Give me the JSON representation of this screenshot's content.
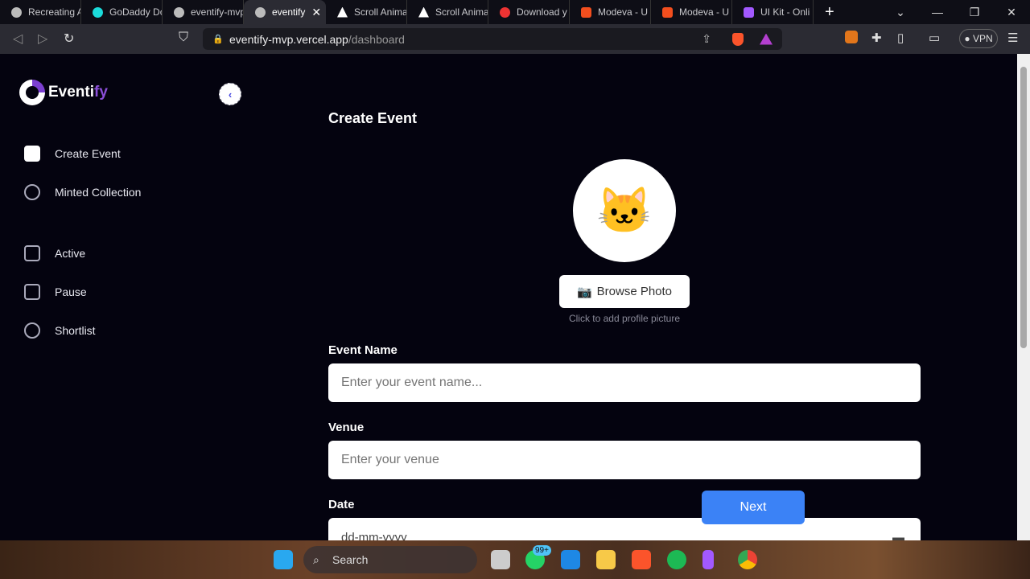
{
  "browser": {
    "tabs": [
      {
        "label": "Recreating A"
      },
      {
        "label": "GoDaddy Do"
      },
      {
        "label": "eventify-mvp"
      },
      {
        "label": "eventify",
        "active": true
      },
      {
        "label": "Scroll Anima"
      },
      {
        "label": "Scroll Anima"
      },
      {
        "label": "Download y"
      },
      {
        "label": "Modeva - U"
      },
      {
        "label": "Modeva - U"
      },
      {
        "label": "UI Kit - Onli"
      }
    ],
    "url_host": "eventify-mvp.vercel.app",
    "url_path": "/dashboard",
    "vpn": "VPN"
  },
  "sidebar": {
    "brand_a": "Eventi",
    "brand_b": "fy",
    "items": [
      {
        "label": "Create Event",
        "icon": "bar-chart-icon"
      },
      {
        "label": "Minted Collection",
        "icon": "collection-icon"
      },
      {
        "label": "Active",
        "icon": "user-card-icon"
      },
      {
        "label": "Pause",
        "icon": "calendar-icon"
      },
      {
        "label": "Shortlist",
        "icon": "search-icon"
      }
    ]
  },
  "main": {
    "title": "Create Event",
    "browse": "Browse Photo",
    "hint": "Click to add profile picture",
    "event_name_label": "Event Name",
    "event_name_placeholder": "Enter your event name...",
    "venue_label": "Venue",
    "venue_placeholder": "Enter your venue",
    "date_label": "Date",
    "date_placeholder": "dd-mm-yyyy",
    "next": "Next"
  },
  "taskbar": {
    "search": "Search",
    "whatsapp_badge": "99+"
  },
  "colors": {
    "accent": "#3b82f6",
    "brand": "#8b4fd8",
    "bg": "#04030f"
  }
}
